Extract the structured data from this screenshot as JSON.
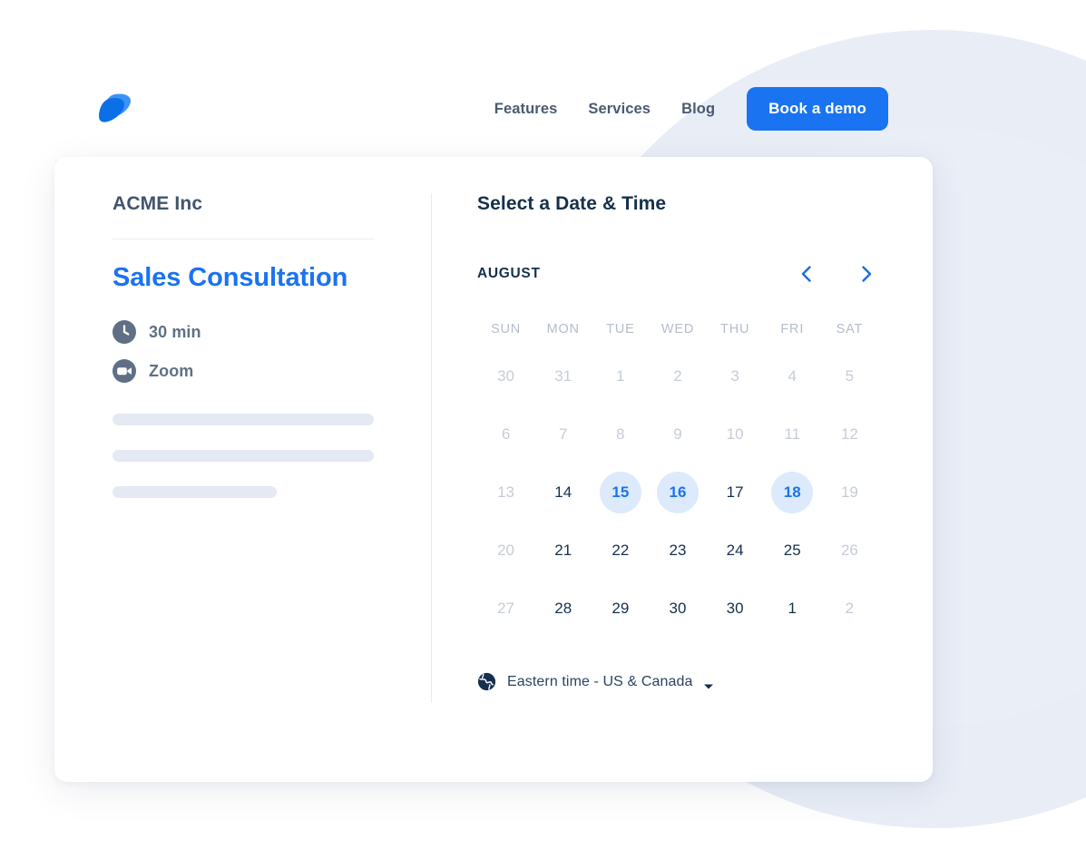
{
  "brand": {
    "logo_icon": "overlapping-leaves-logo",
    "primary_color": "#1a73f0",
    "accent_light": "#ddeafc"
  },
  "header": {
    "nav": [
      {
        "label": "Features",
        "name": "nav-link-features"
      },
      {
        "label": "Services",
        "name": "nav-link-services"
      },
      {
        "label": "Blog",
        "name": "nav-link-blog"
      }
    ],
    "cta_label": "Book a demo"
  },
  "booking": {
    "organization": "ACME Inc",
    "event_title": "Sales Consultation",
    "details": [
      {
        "icon": "clock-icon",
        "label": "30 min"
      },
      {
        "icon": "video-camera-icon",
        "label": "Zoom"
      }
    ],
    "description_placeholder_lines": 3
  },
  "scheduler": {
    "title": "Select a Date & Time",
    "month_label": "AUGUST",
    "prev_icon": "chevron-left-icon",
    "next_icon": "chevron-right-icon",
    "weekdays": [
      "SUN",
      "MON",
      "TUE",
      "WED",
      "THU",
      "FRI",
      "SAT"
    ],
    "weeks": [
      [
        {
          "day": "30",
          "state": "muted"
        },
        {
          "day": "31",
          "state": "muted"
        },
        {
          "day": "1",
          "state": "muted"
        },
        {
          "day": "2",
          "state": "muted"
        },
        {
          "day": "3",
          "state": "muted"
        },
        {
          "day": "4",
          "state": "muted"
        },
        {
          "day": "5",
          "state": "muted"
        }
      ],
      [
        {
          "day": "6",
          "state": "muted"
        },
        {
          "day": "7",
          "state": "muted"
        },
        {
          "day": "8",
          "state": "muted"
        },
        {
          "day": "9",
          "state": "muted"
        },
        {
          "day": "10",
          "state": "muted"
        },
        {
          "day": "11",
          "state": "muted"
        },
        {
          "day": "12",
          "state": "muted"
        }
      ],
      [
        {
          "day": "13",
          "state": "muted"
        },
        {
          "day": "14",
          "state": "normal"
        },
        {
          "day": "15",
          "state": "available"
        },
        {
          "day": "16",
          "state": "available"
        },
        {
          "day": "17",
          "state": "normal"
        },
        {
          "day": "18",
          "state": "available"
        },
        {
          "day": "19",
          "state": "muted"
        }
      ],
      [
        {
          "day": "20",
          "state": "muted"
        },
        {
          "day": "21",
          "state": "normal"
        },
        {
          "day": "22",
          "state": "normal"
        },
        {
          "day": "23",
          "state": "normal"
        },
        {
          "day": "24",
          "state": "normal"
        },
        {
          "day": "25",
          "state": "normal"
        },
        {
          "day": "26",
          "state": "muted"
        }
      ],
      [
        {
          "day": "27",
          "state": "muted"
        },
        {
          "day": "28",
          "state": "normal"
        },
        {
          "day": "29",
          "state": "normal"
        },
        {
          "day": "30",
          "state": "normal"
        },
        {
          "day": "30",
          "state": "normal"
        },
        {
          "day": "1",
          "state": "normal"
        },
        {
          "day": "2",
          "state": "muted"
        }
      ]
    ],
    "timezone": {
      "icon": "globe-icon",
      "label": "Eastern time - US & Canada",
      "caret_icon": "caret-down-icon"
    }
  }
}
